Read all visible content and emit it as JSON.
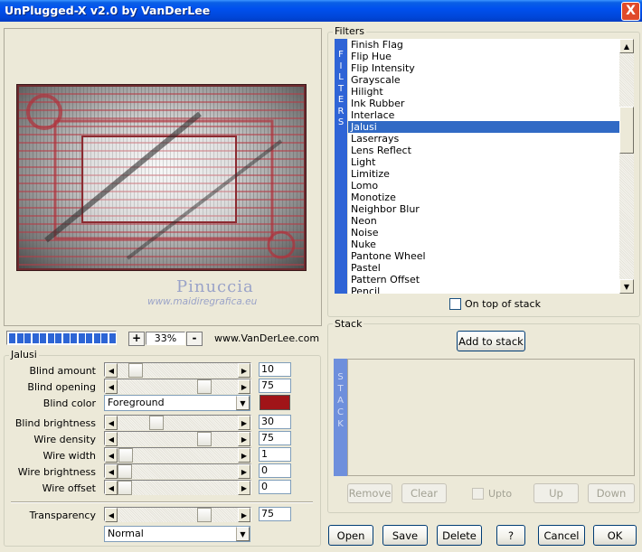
{
  "window": {
    "title": "UnPlugged-X v2.0 by VanDerLee",
    "close_glyph": "X"
  },
  "preview": {
    "watermark_name": "Pinuccia",
    "watermark_url": "www.maidiregrafica.eu"
  },
  "progress": {
    "segments": 14
  },
  "zoom": {
    "minus": "-",
    "plus": "+",
    "value": "33%"
  },
  "vanderlee_link": "www.VanDerLee.com",
  "jalusi": {
    "group_title": "Jalusi",
    "params": [
      {
        "label": "Blind amount",
        "value": "10",
        "fraction": 0.1
      },
      {
        "label": "Blind opening",
        "value": "75",
        "fraction": 0.75
      },
      {
        "label": "Blind brightness",
        "value": "30",
        "fraction": 0.3
      },
      {
        "label": "Wire density",
        "value": "75",
        "fraction": 0.75
      },
      {
        "label": "Wire width",
        "value": "1",
        "fraction": 0.01
      },
      {
        "label": "Wire brightness",
        "value": "0",
        "fraction": 0.0
      },
      {
        "label": "Wire offset",
        "value": "0",
        "fraction": 0.0
      }
    ],
    "blind_color_label": "Blind color",
    "blind_color_value": "Foreground",
    "blind_color_swatch": "#a01418",
    "transparency_label": "Transparency",
    "transparency_value": "75",
    "transparency_fraction": 0.75,
    "blend_mode": "Normal"
  },
  "filters": {
    "group_title": "Filters",
    "strip_letters": [
      "F",
      "I",
      "L",
      "T",
      "E",
      "R",
      "S"
    ],
    "items": [
      "Finish Flag",
      "Flip Hue",
      "Flip Intensity",
      "Grayscale",
      "Hilight",
      "Ink Rubber",
      "Interlace",
      "Jalusi",
      "Laserrays",
      "Lens Reflect",
      "Light",
      "Limitize",
      "Lomo",
      "Monotize",
      "Neighbor Blur",
      "Neon",
      "Noise",
      "Nuke",
      "Pantone Wheel",
      "Pastel",
      "Pattern Offset",
      "Pencil"
    ],
    "selected_index": 7,
    "on_top_label": "On top of stack"
  },
  "stack": {
    "group_title": "Stack",
    "add_label": "Add to stack",
    "strip_letters": [
      "S",
      "T",
      "A",
      "C",
      "K"
    ],
    "remove_label": "Remove",
    "clear_label": "Clear",
    "upto_label": "Upto",
    "up_label": "Up",
    "down_label": "Down"
  },
  "buttons": {
    "open": "Open",
    "save": "Save",
    "delete": "Delete",
    "help": "?",
    "cancel": "Cancel",
    "ok": "OK"
  },
  "icons": {
    "scroll_up": "▲",
    "scroll_down": "▼",
    "arrow_left": "◀",
    "arrow_right": "▶",
    "combo_down": "▼"
  }
}
